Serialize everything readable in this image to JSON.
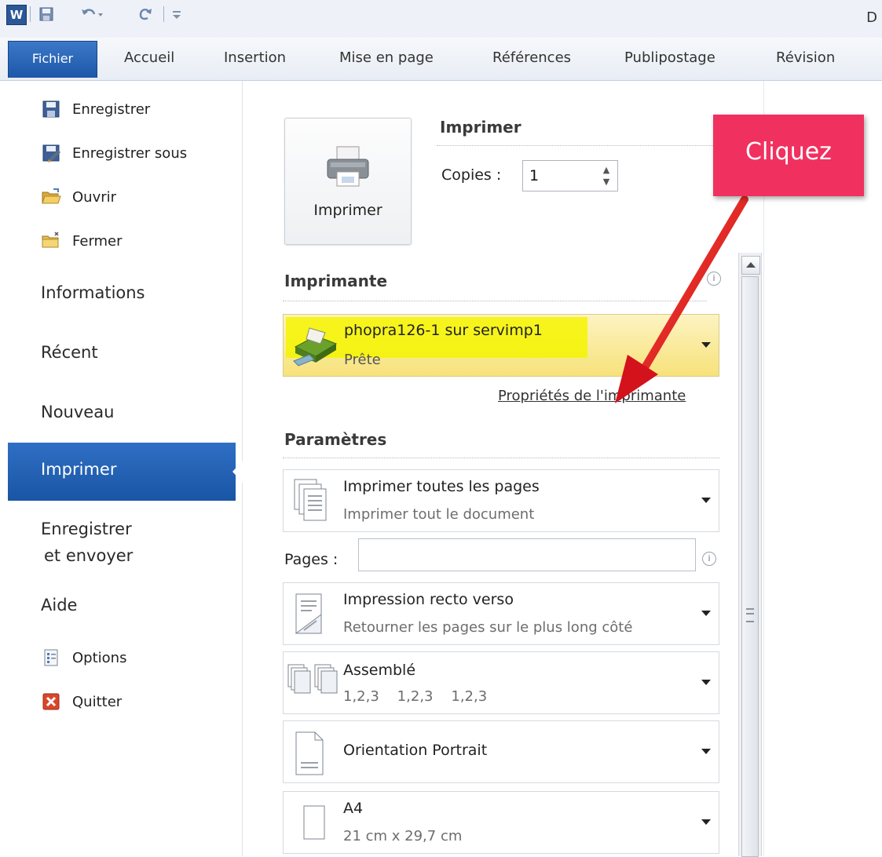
{
  "app": {
    "logo_letter": "W",
    "title_glyph": "D"
  },
  "tabs": [
    {
      "label": "Fichier",
      "active": true
    },
    {
      "label": "Accueil"
    },
    {
      "label": "Insertion"
    },
    {
      "label": "Mise en page"
    },
    {
      "label": "Références"
    },
    {
      "label": "Publipostage"
    },
    {
      "label": "Révision"
    }
  ],
  "sidebar": {
    "small_items": [
      {
        "label": "Enregistrer",
        "icon": "save-icon"
      },
      {
        "label": "Enregistrer sous",
        "icon": "save-as-icon"
      },
      {
        "label": "Ouvrir",
        "icon": "open-folder-icon"
      },
      {
        "label": "Fermer",
        "icon": "close-folder-icon"
      }
    ],
    "big_items": [
      {
        "label": "Informations"
      },
      {
        "label": "Récent"
      },
      {
        "label": "Nouveau"
      },
      {
        "label": "Imprimer",
        "selected": true
      },
      {
        "label_line1": "Enregistrer",
        "label_line2": "et envoyer"
      },
      {
        "label": "Aide"
      }
    ],
    "bottom_items": [
      {
        "label": "Options",
        "icon": "options-icon"
      },
      {
        "label": "Quitter",
        "icon": "exit-icon"
      }
    ]
  },
  "print": {
    "button_label": "Imprimer",
    "section_title": "Imprimer",
    "copies_label": "Copies :",
    "copies_value": "1"
  },
  "printer": {
    "section_title": "Imprimante",
    "name": "phopra126-1 sur servimp1",
    "status": "Prête",
    "properties_link": "Propriétés de l'imprimante"
  },
  "settings": {
    "section_title": "Paramètres",
    "pages_label": "Pages :",
    "pages_value": "",
    "items": [
      {
        "title": "Imprimer toutes les pages",
        "subtitle": "Imprimer tout le document",
        "icon": "pages-stack-icon"
      },
      {
        "title": "Impression recto verso",
        "subtitle": "Retourner les pages sur le plus long côté",
        "icon": "duplex-icon"
      },
      {
        "title": "Assemblé",
        "subtitle": "1,2,3    1,2,3    1,2,3",
        "icon": "collate-icon"
      },
      {
        "title": "Orientation Portrait",
        "subtitle": "",
        "icon": "portrait-page-icon"
      },
      {
        "title": "A4",
        "subtitle": "21 cm x 29,7 cm",
        "icon": "paper-size-icon"
      }
    ]
  },
  "callout": {
    "text": "Cliquez",
    "color": "#f0305f"
  },
  "colors": {
    "file_tab": "#1d57a8",
    "selected_nav": "#1a55a5",
    "printer_highlight": "#f4f400",
    "arrow": "#e0121a"
  }
}
